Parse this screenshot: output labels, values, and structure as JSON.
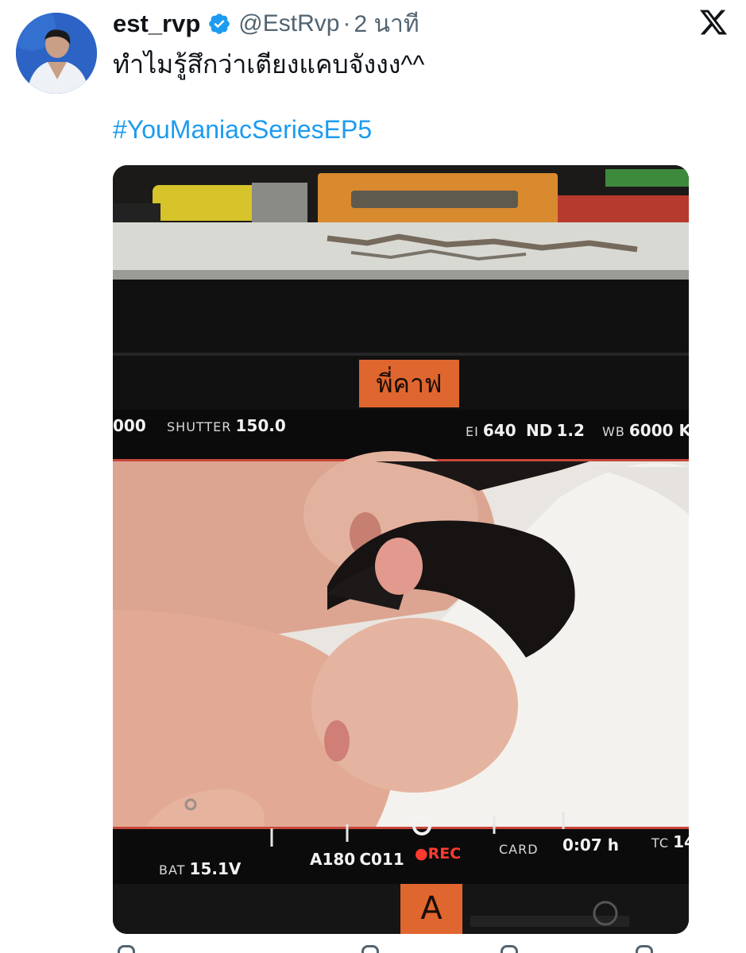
{
  "post": {
    "display_name": "est_rvp",
    "handle": "@EstRvp",
    "separator": "·",
    "time": "2 นาที",
    "text": "ทำไมรู้สึกว่าเตียงแคบจังงง^^",
    "hashtag": "#YouManiacSeriesEP5"
  },
  "icons": {
    "verified": "verified-badge-icon",
    "platform": "x-logo-icon"
  },
  "photo": {
    "tape_top": "พี่คาฟ",
    "tape_bottom": "A",
    "hud_top": {
      "iso_partial": "000",
      "shutter_label": "SHUTTER",
      "shutter_value": "150.0",
      "ei_label": "EI",
      "ei_value": "640",
      "nd_label": "ND",
      "nd_value": "1.2",
      "wb_label": "WB",
      "wb_value": "6000 K"
    },
    "hud_bottom": {
      "bat_label": "BAT",
      "bat_value": "15.1V",
      "reel": "A180",
      "clip": "C011",
      "rec": "●REC",
      "card_label": "CARD",
      "card_value": "0:07 h",
      "tc_label": "TC",
      "tc_value": "14"
    }
  },
  "colors": {
    "link": "#1d9bf0",
    "verified": "#1d9bf0",
    "text": "#0f1419",
    "muted": "#536471",
    "rec": "#ff3b30",
    "tape": "#e0662f"
  }
}
